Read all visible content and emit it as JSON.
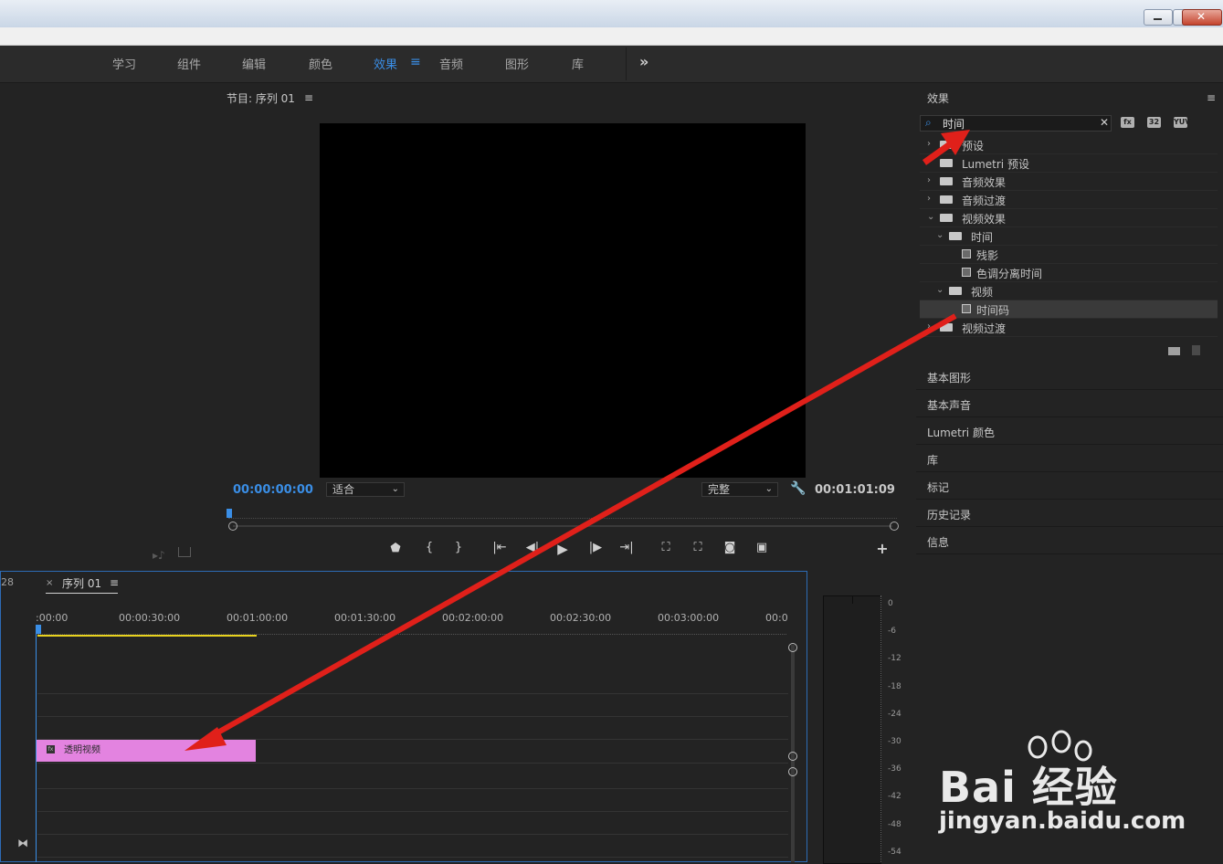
{
  "workspace_tabs": [
    "学习",
    "组件",
    "编辑",
    "颜色",
    "效果",
    "音频",
    "图形",
    "库"
  ],
  "workspace_active": "效果",
  "workspace_more_icon": "double-chevron-right-icon",
  "program": {
    "title": "节目: 序列 01",
    "timecode_current": "00:00:00:00",
    "timecode_duration": "00:01:01:09",
    "zoom_select": "适合",
    "quality_select": "完整"
  },
  "effects": {
    "title": "效果",
    "search_value": "时间",
    "tree": [
      {
        "label": "预设",
        "level": 0,
        "expanded": false,
        "kind": "folder"
      },
      {
        "label": "Lumetri 预设",
        "level": 0,
        "expanded": false,
        "kind": "folder-star"
      },
      {
        "label": "音频效果",
        "level": 0,
        "expanded": false,
        "kind": "folder"
      },
      {
        "label": "音频过渡",
        "level": 0,
        "expanded": false,
        "kind": "folder"
      },
      {
        "label": "视频效果",
        "level": 0,
        "expanded": true,
        "kind": "folder"
      },
      {
        "label": "时间",
        "level": 1,
        "expanded": true,
        "kind": "folder"
      },
      {
        "label": "残影",
        "level": 2,
        "kind": "effect"
      },
      {
        "label": "色调分离时间",
        "level": 2,
        "kind": "effect"
      },
      {
        "label": "视频",
        "level": 1,
        "expanded": true,
        "kind": "folder"
      },
      {
        "label": "时间码",
        "level": 2,
        "kind": "effect",
        "selected": true
      },
      {
        "label": "视频过渡",
        "level": 0,
        "expanded": false,
        "kind": "folder"
      }
    ],
    "badges": [
      "fx",
      "32",
      "YUV"
    ]
  },
  "right_panels": [
    "基本图形",
    "基本声音",
    "Lumetri 颜色",
    "库",
    "标记",
    "历史记录",
    "信息"
  ],
  "timeline": {
    "left_number": "28",
    "tab_label": "序列 01",
    "ruler": [
      ":00:00",
      "00:00:30:00",
      "00:01:00:00",
      "00:01:30:00",
      "00:02:00:00",
      "00:02:30:00",
      "00:03:00:00",
      "00:0"
    ],
    "clip_label": "透明视频",
    "clip_color": "#e383e0"
  },
  "meter_scale": [
    "0",
    "-6",
    "-12",
    "-18",
    "-24",
    "-30",
    "-36",
    "-42",
    "-48",
    "-54"
  ],
  "watermark": {
    "brand": "Bai 经验",
    "url": "jingyan.baidu.com"
  },
  "colors": {
    "accent_blue": "#3a8ee6",
    "arrow_red": "#e0201a",
    "playhead_yellow": "#e8d21e"
  }
}
